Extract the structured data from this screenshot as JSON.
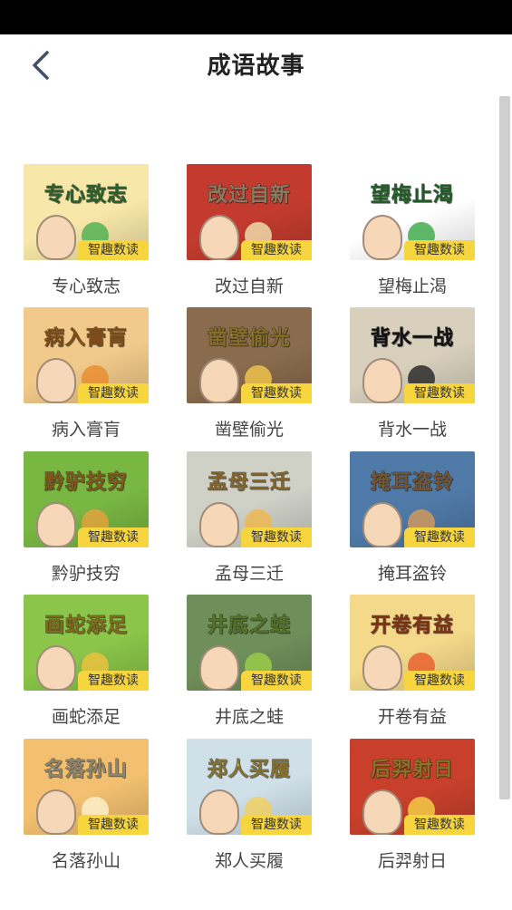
{
  "header": {
    "title": "成语故事",
    "back_icon": "chevron-left-icon"
  },
  "badge_label": "智趣数读",
  "stories": [
    {
      "title": "专心致志",
      "art_text": "专心致志",
      "bg": "#f7e7a8",
      "accent": "#4caf50"
    },
    {
      "title": "改过自新",
      "art_text": "改过自新",
      "bg": "#c23b2e",
      "accent": "#f3e3b4"
    },
    {
      "title": "望梅止渴",
      "art_text": "望梅止渴",
      "bg": "#ffffff",
      "accent": "#3aa845"
    },
    {
      "title": "病入膏肓",
      "art_text": "病入膏肓",
      "bg": "#f1c98a",
      "accent": "#e88b2c"
    },
    {
      "title": "凿壁偷光",
      "art_text": "凿壁偷光",
      "bg": "#8a6b4d",
      "accent": "#f2c84b"
    },
    {
      "title": "背水一战",
      "art_text": "背水一战",
      "bg": "#d8d0bd",
      "accent": "#222222"
    },
    {
      "title": "黔驴技穷",
      "art_text": "黔驴技穷",
      "bg": "#79b743",
      "accent": "#e9a23b"
    },
    {
      "title": "孟母三迁",
      "art_text": "孟母三迁",
      "bg": "#cfd1c7",
      "accent": "#f0b64a"
    },
    {
      "title": "掩耳盗铃",
      "art_text": "掩耳盗铃",
      "bg": "#4f7aa8",
      "accent": "#d89b5a"
    },
    {
      "title": "画蛇添足",
      "art_text": "画蛇添足",
      "bg": "#8bc64a",
      "accent": "#f0c23d"
    },
    {
      "title": "井底之蛙",
      "art_text": "井底之蛙",
      "bg": "#6f8f5a",
      "accent": "#9ccf4a"
    },
    {
      "title": "开卷有益",
      "art_text": "开卷有益",
      "bg": "#f4d98a",
      "accent": "#e85a2c"
    },
    {
      "title": "名落孙山",
      "art_text": "名落孙山",
      "bg": "#f2c070",
      "accent": "#fff3d0"
    },
    {
      "title": "郑人买履",
      "art_text": "郑人买履",
      "bg": "#cfe0e8",
      "accent": "#f2d05a"
    },
    {
      "title": "后羿射日",
      "art_text": "后羿射日",
      "bg": "#c8402c",
      "accent": "#f7d54a"
    }
  ]
}
